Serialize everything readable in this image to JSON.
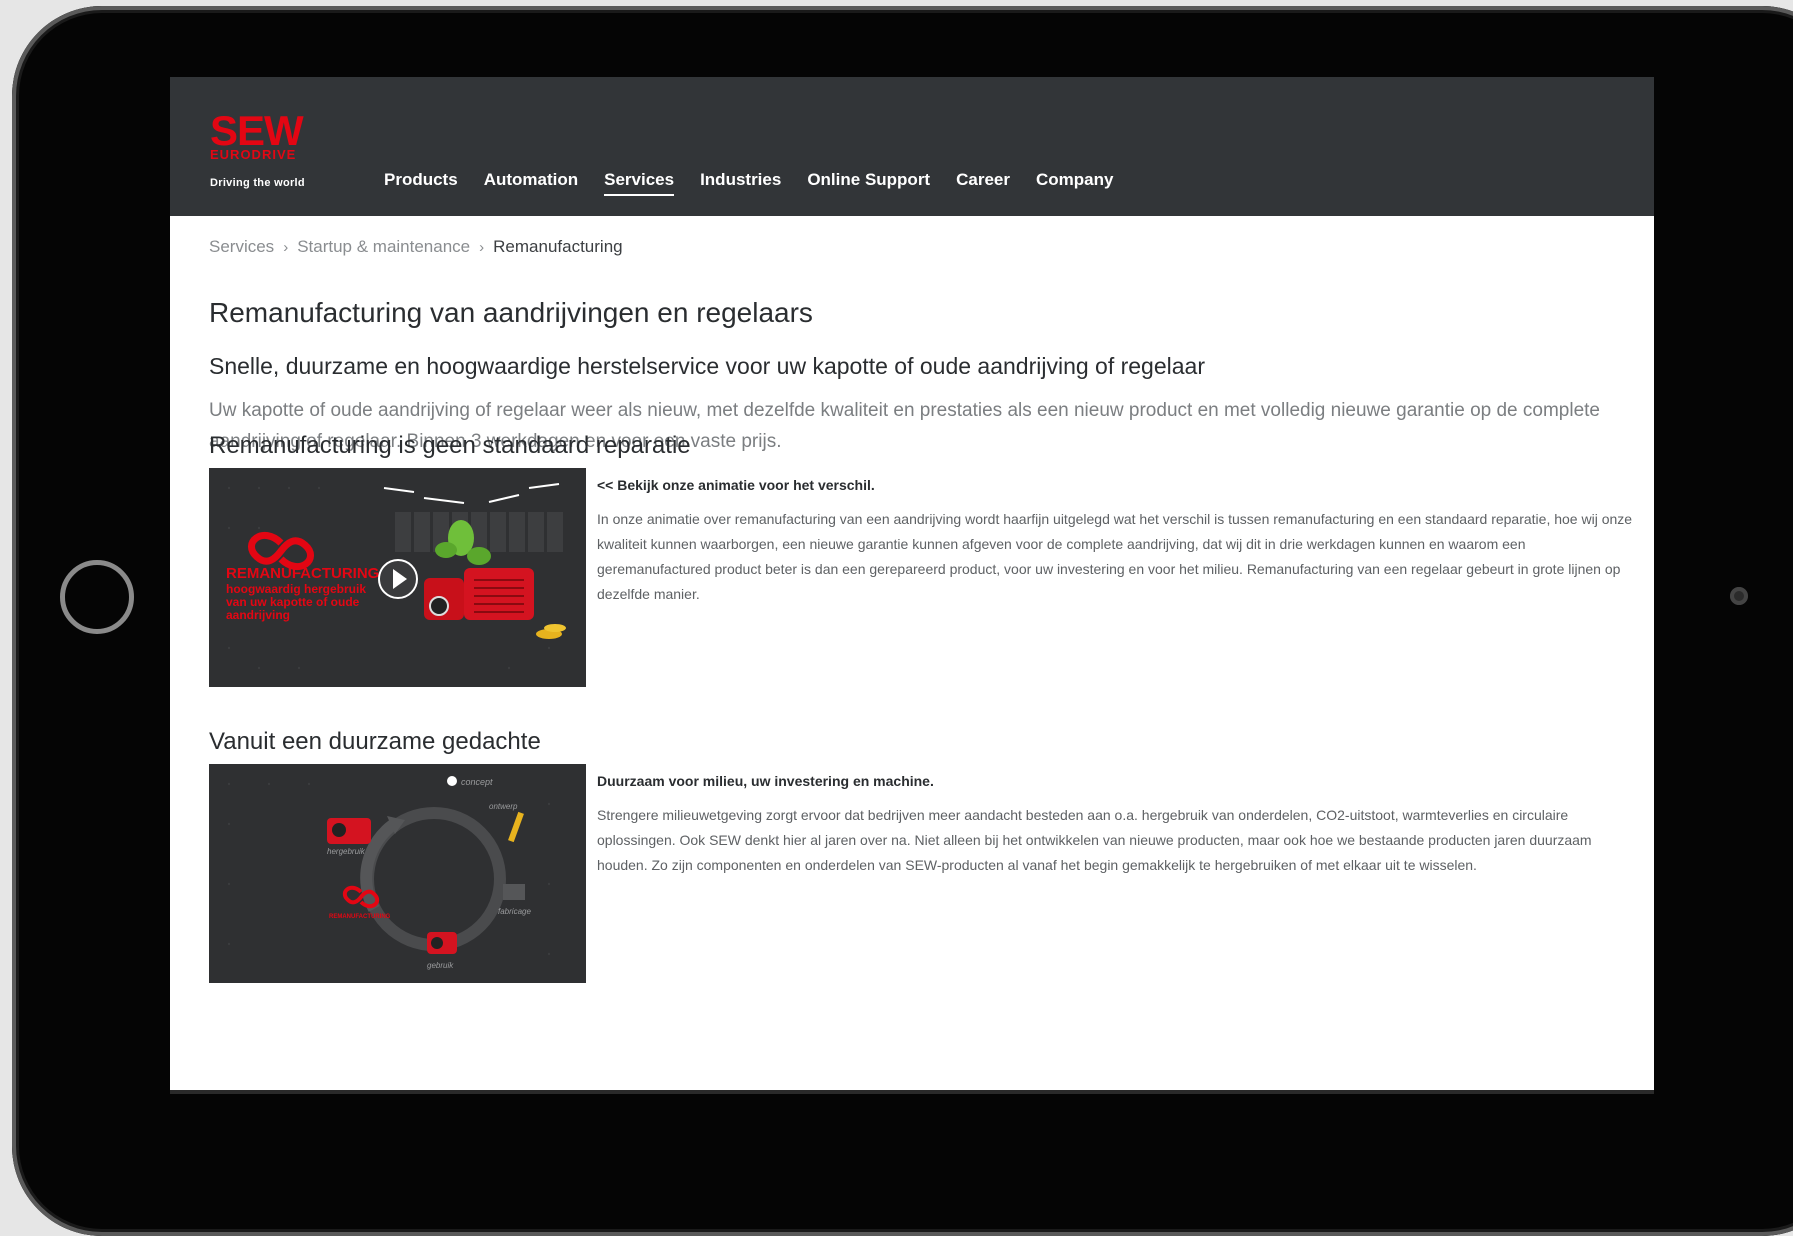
{
  "logo": {
    "brand": "SEW",
    "sub": "EURODRIVE",
    "tagline": "Driving the world"
  },
  "nav": {
    "items": [
      {
        "label": "Products"
      },
      {
        "label": "Automation"
      },
      {
        "label": "Services",
        "active": true
      },
      {
        "label": "Industries"
      },
      {
        "label": "Online Support"
      },
      {
        "label": "Career"
      },
      {
        "label": "Company"
      }
    ]
  },
  "breadcrumb": {
    "items": [
      "Services",
      "Startup & maintenance"
    ],
    "current": "Remanufacturing"
  },
  "page": {
    "title": "Remanufacturing van aandrijvingen en regelaars",
    "subtitle": "Snelle, duurzame en hoogwaardige herstelservice voor uw kapotte of oude aandrijving of regelaar",
    "intro": "Uw kapotte of oude aandrijving of regelaar weer als nieuw, met dezelfde kwaliteit en prestaties als een nieuw product en met volledig nieuwe garantie op de complete aandrijving of regelaar. Binnen 3 werkdagen en voor een vaste prijs."
  },
  "sections": [
    {
      "heading": "Remanufacturing is geen standaard reparatie",
      "lead": "<< Bekijk onze animatie voor het verschil.",
      "body": "In onze animatie over remanufacturing van een aandrijving wordt haarfijn uitgelegd wat het verschil is tussen remanufacturing en een standaard reparatie, hoe wij onze kwaliteit kunnen waarborgen, een nieuwe garantie kunnen afgeven voor de complete aandrijving, dat wij dit in drie werkdagen kunnen en waarom een geremanufactured product beter is dan een gerepareerd product, voor uw investering en voor het milieu. Remanufacturing van een regelaar gebeurt in grote lijnen op dezelfde manier.",
      "media": {
        "title": "REMANUFACTURING",
        "caption_lines": [
          "hoogwaardig hergebruik",
          "van uw kapotte of oude",
          "aandrijving"
        ]
      }
    },
    {
      "heading": "Vanuit een duurzame gedachte",
      "lead": "Duurzaam voor milieu, uw investering en machine.",
      "body": "Strengere milieuwetgeving zorgt ervoor dat bedrijven meer aandacht besteden aan o.a. hergebruik van onderdelen, CO2-uitstoot, warmteverlies en circulaire oplossingen. Ook SEW denkt hier al jaren over na. Niet alleen bij het ontwikkelen van nieuwe producten, maar ook hoe we bestaande producten jaren duurzaam houden. Zo zijn componenten en onderdelen van SEW-producten al vanaf het begin gemakkelijk te hergebruiken of met elkaar uit te wisselen.",
      "media": {
        "title": "REMANUFACTURING",
        "cycle_labels": [
          "concept",
          "ontwerp",
          "fabricage",
          "gebruik",
          "hergebruik"
        ]
      }
    }
  ],
  "colors": {
    "brand": "#e30613",
    "header": "#323538",
    "text": "#2a2d30",
    "muted": "#7b7e81"
  }
}
